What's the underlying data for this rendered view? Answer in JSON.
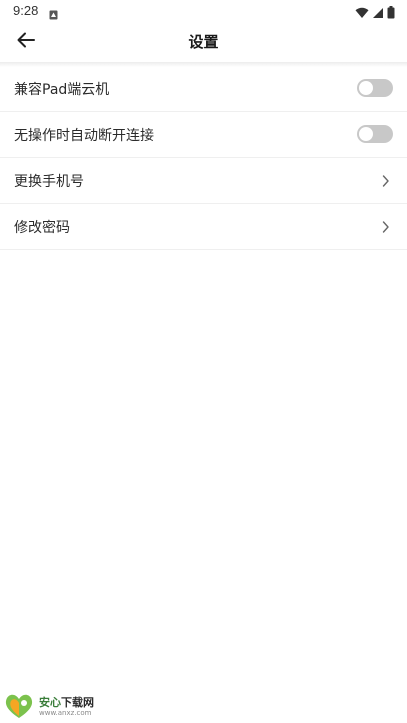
{
  "status_bar": {
    "time": "9:28",
    "icons": [
      "notification-icon",
      "wifi-icon",
      "signal-icon",
      "battery-icon"
    ]
  },
  "app_bar": {
    "back_icon": "arrow-left-icon",
    "title": "设置"
  },
  "settings": {
    "items": [
      {
        "label": "兼容Pad端云机",
        "control": "toggle",
        "enabled": false
      },
      {
        "label": "无操作时自动断开连接",
        "control": "toggle",
        "enabled": false
      },
      {
        "label": "更换手机号",
        "control": "chevron-right-icon"
      },
      {
        "label": "修改密码",
        "control": "chevron-right-icon"
      }
    ]
  },
  "watermark": {
    "brand_main": "安心",
    "brand_rest": "下载网",
    "url": "www.anxz.com",
    "logo_icon": "heart-leaf-logo"
  },
  "colors": {
    "background": "#ffffff",
    "toggle_off": "#c8c8c8",
    "divider": "#efefef",
    "text": "#2b2b2b"
  }
}
